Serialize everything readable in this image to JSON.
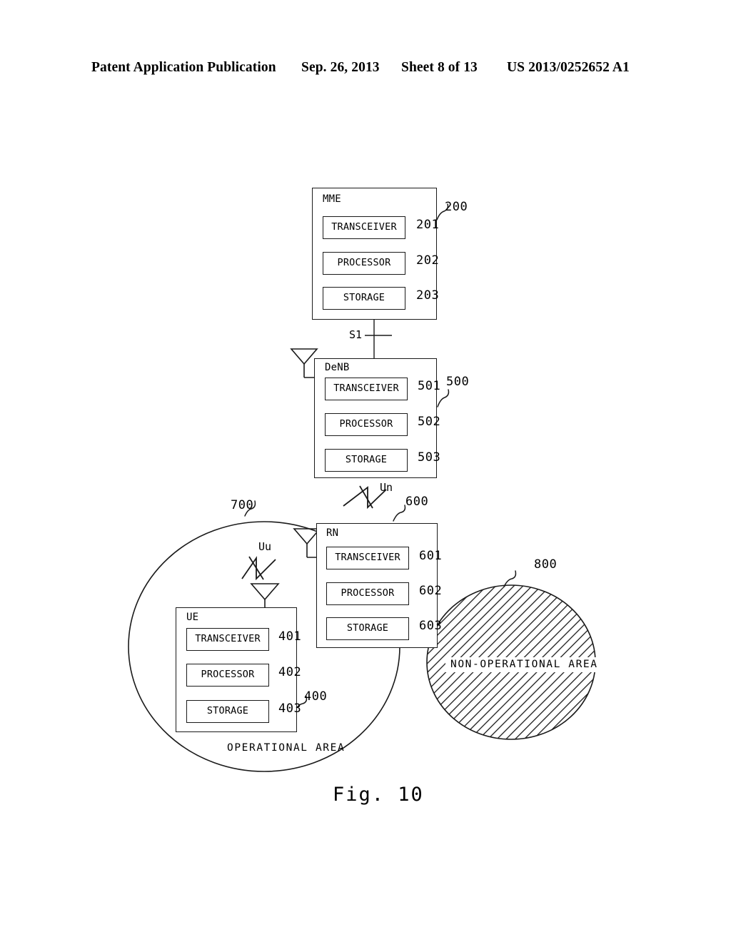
{
  "header": {
    "publication": "Patent Application Publication",
    "date": "Sep. 26, 2013",
    "sheet": "Sheet 8 of 13",
    "patent_number": "US 2013/0252652 A1"
  },
  "figure": {
    "caption": "Fig. 10",
    "nodes": [
      {
        "id": "mme",
        "title": "MME",
        "ref": "200",
        "parts": [
          {
            "label": "TRANSCEIVER",
            "ref": "201"
          },
          {
            "label": "PROCESSOR",
            "ref": "202"
          },
          {
            "label": "STORAGE",
            "ref": "203"
          }
        ]
      },
      {
        "id": "denb",
        "title": "DeNB",
        "ref": "500",
        "parts": [
          {
            "label": "TRANSCEIVER",
            "ref": "501"
          },
          {
            "label": "PROCESSOR",
            "ref": "502"
          },
          {
            "label": "STORAGE",
            "ref": "503"
          }
        ]
      },
      {
        "id": "rn",
        "title": "RN",
        "ref": "600",
        "parts": [
          {
            "label": "TRANSCEIVER",
            "ref": "601"
          },
          {
            "label": "PROCESSOR",
            "ref": "602"
          },
          {
            "label": "STORAGE",
            "ref": "603"
          }
        ]
      },
      {
        "id": "ue",
        "title": "UE",
        "ref": "400",
        "parts": [
          {
            "label": "TRANSCEIVER",
            "ref": "401"
          },
          {
            "label": "PROCESSOR",
            "ref": "402"
          },
          {
            "label": "STORAGE",
            "ref": "403"
          }
        ]
      }
    ],
    "links": [
      {
        "id": "s1",
        "label": "S1",
        "kind": "wired",
        "from": "mme",
        "to": "denb"
      },
      {
        "id": "un",
        "label": "Un",
        "kind": "wireless",
        "from": "denb",
        "to": "rn"
      },
      {
        "id": "uu",
        "label": "Uu",
        "kind": "wireless",
        "from": "rn",
        "to": "ue"
      }
    ],
    "areas": [
      {
        "id": "operational",
        "label": "OPERATIONAL AREA",
        "ref": "700",
        "hatched": false
      },
      {
        "id": "non-operational",
        "label": "NON-OPERATIONAL AREA",
        "ref": "800",
        "hatched": true
      }
    ]
  }
}
